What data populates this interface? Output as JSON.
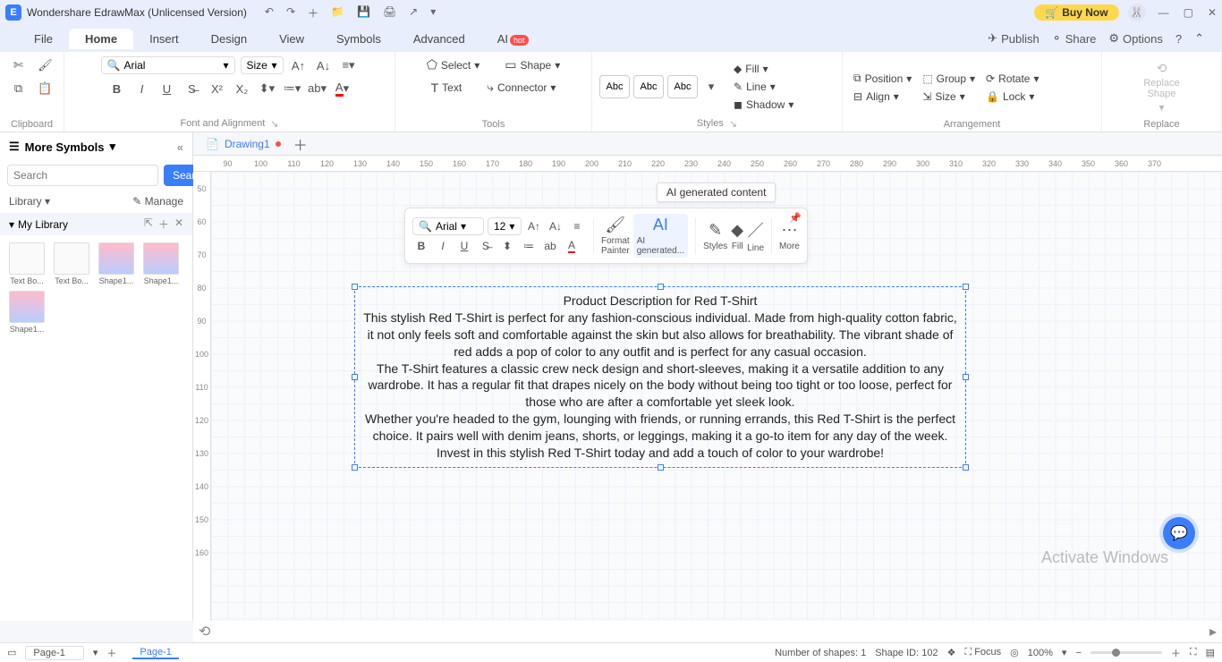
{
  "app": {
    "title": "Wondershare EdrawMax (Unlicensed Version)",
    "buy": "Buy Now"
  },
  "menu": {
    "items": [
      "File",
      "Home",
      "Insert",
      "Design",
      "View",
      "Symbols",
      "Advanced",
      "AI"
    ],
    "active": "Home",
    "right": {
      "publish": "Publish",
      "share": "Share",
      "options": "Options"
    }
  },
  "ribbon": {
    "font": "Arial",
    "size": "Size",
    "groups": {
      "clipboard": "Clipboard",
      "fontalign": "Font and Alignment",
      "tools": "Tools",
      "styles": "Styles",
      "arrangement": "Arrangement",
      "replace": "Replace"
    },
    "tools": {
      "select": "Select",
      "shape": "Shape",
      "text": "Text",
      "connector": "Connector"
    },
    "abc": "Abc",
    "fill": "Fill",
    "line": "Line",
    "shadow": "Shadow",
    "position": "Position",
    "align": "Align",
    "group": "Group",
    "rotate": "Rotate",
    "lock": "Lock",
    "replaceShape": "Replace\nShape"
  },
  "side": {
    "header": "More Symbols",
    "searchPlaceholder": "Search",
    "searchBtn": "Search",
    "library": "Library",
    "manage": "Manage",
    "mylib": "My Library",
    "thumbs": [
      "Text Bo...",
      "Text Bo...",
      "Shape1...",
      "Shape1...",
      "Shape1..."
    ]
  },
  "doc": {
    "tab": "Drawing1",
    "rulerH": [
      "90",
      "100",
      "110",
      "120",
      "130",
      "140",
      "150",
      "160",
      "170",
      "180",
      "190",
      "200",
      "210",
      "220",
      "230",
      "240",
      "250",
      "260",
      "270",
      "280",
      "290",
      "300",
      "310",
      "320",
      "330",
      "340",
      "350",
      "360",
      "370"
    ],
    "rulerV": [
      "50",
      "60",
      "70",
      "80",
      "90",
      "100",
      "110",
      "120",
      "130",
      "140",
      "150",
      "160"
    ]
  },
  "tooltip": "AI generated content",
  "textbox": {
    "title": "Product Description for Red T-Shirt",
    "p1": "This stylish Red T-Shirt is perfect for any fashion-conscious individual. Made from high-quality cotton fabric, it not only feels soft and comfortable against the skin but also allows for breathability. The vibrant shade of red adds a pop of color to any outfit and is perfect for any casual occasion.",
    "p2": "The T-Shirt features a classic crew neck design and short-sleeves, making it a versatile addition to any wardrobe. It has a regular fit that drapes nicely on the body without being too tight or too loose, perfect for those who are after a comfortable yet sleek look.",
    "p3": "Whether you're headed to the gym, lounging with friends, or running errands, this Red T-Shirt is the perfect choice. It pairs well with denim jeans, shorts, or leggings, making it a go-to item for any day of the week.",
    "p4": "Invest in this stylish Red T-Shirt today and add a touch of color to your wardrobe!"
  },
  "float": {
    "font": "Arial",
    "size": "12",
    "format": "Format\nPainter",
    "ai": "AI\ngenerated...",
    "styles": "Styles",
    "fill": "Fill",
    "line": "Line",
    "more": "More"
  },
  "status": {
    "pageDrop": "Page-1",
    "pageTab": "Page-1",
    "shapes": "Number of shapes: 1",
    "shapeId": "Shape ID: 102",
    "focus": "Focus",
    "zoom": "100%"
  },
  "watermark": "Activate Windows",
  "colors": [
    "#000000",
    "#8b0000",
    "#b22222",
    "#dc143c",
    "#ff0000",
    "#ff4500",
    "#ff6347",
    "#ff7f50",
    "#ffa07a",
    "#ffb6c1",
    "#ffc0cb",
    "#ffd1dc",
    "#ff69b4",
    "#ff1493",
    "#db7093",
    "#c71585",
    "#d2691e",
    "#cd853f",
    "#daa520",
    "#b8860b",
    "#ffd700",
    "#ffff00",
    "#fffacd",
    "#fafad2",
    "#9acd32",
    "#adff2f",
    "#7fff00",
    "#7cfc00",
    "#00ff00",
    "#32cd32",
    "#228b22",
    "#008000",
    "#006400",
    "#2e8b57",
    "#3cb371",
    "#66cdaa",
    "#8fbc8f",
    "#20b2aa",
    "#00ced1",
    "#48d1cc",
    "#40e0d0",
    "#00ffff",
    "#afeeee",
    "#add8e6",
    "#87ceeb",
    "#87cefa",
    "#6495ed",
    "#4169e1",
    "#0000ff",
    "#0000cd",
    "#00008b",
    "#191970",
    "#483d8b",
    "#6a5acd",
    "#7b68ee",
    "#8a2be2",
    "#9370db",
    "#9932cc",
    "#ba55d3",
    "#da70d6",
    "#c0c0c0",
    "#a9a9a9",
    "#808080",
    "#696969",
    "#2f4f4f",
    "#556b2f",
    "#8b4513",
    "#a0522d",
    "#bc8f8f",
    "#d2b48c",
    "#deb887",
    "#f5deb3",
    "#ffe4c4",
    "#faebd7",
    "#ffffff"
  ]
}
